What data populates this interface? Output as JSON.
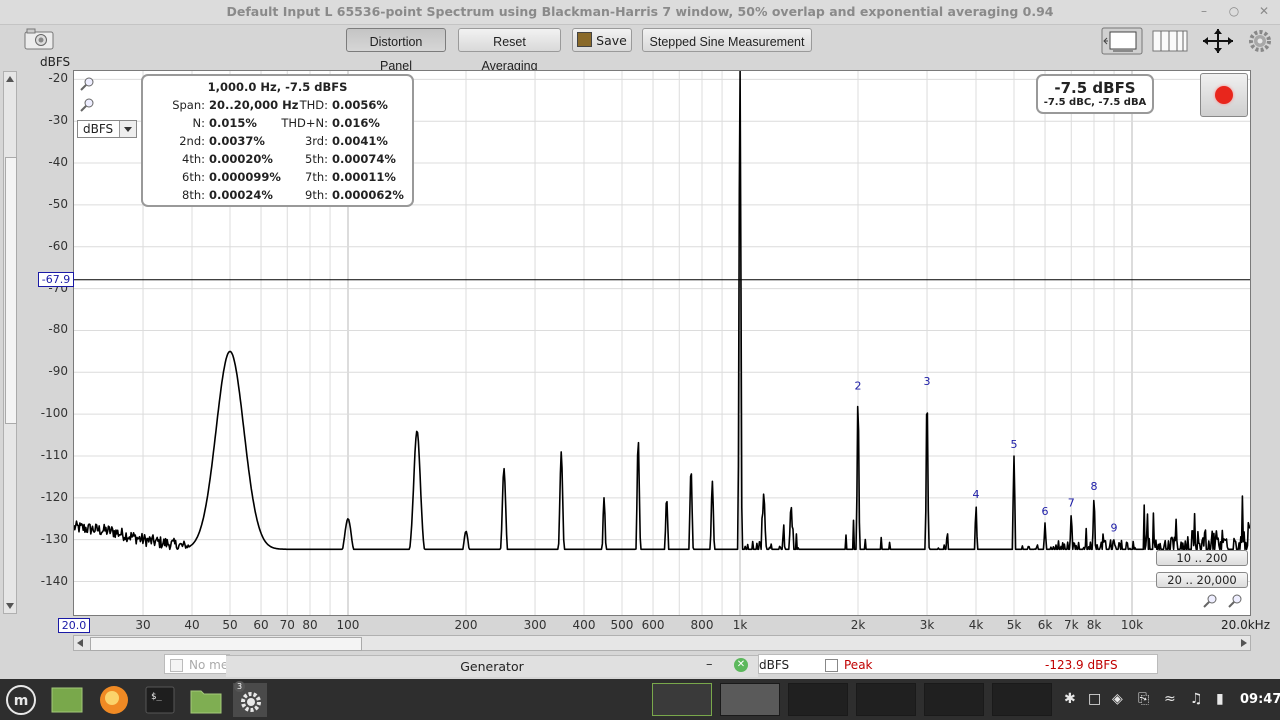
{
  "window": {
    "title": "Default Input L 65536-point Spectrum using Blackman-Harris 7 window, 50% overlap and exponential averaging 0.94"
  },
  "toolbar": {
    "distortion_panel": "Distortion Panel",
    "reset_averaging": "Reset Averaging",
    "save": "Save",
    "stepped_sine": "Stepped Sine Measurement"
  },
  "plot": {
    "y_unit": "dBFS",
    "unit_select": "dBFS",
    "cursor_level": "-67.9",
    "x_min_label": "20.0",
    "x_max_label": "20.0kHz",
    "range_y": "10 .. 200",
    "range_x": "20 .. 20,000"
  },
  "distortion": {
    "header": "1,000.0 Hz, -7.5 dBFS",
    "rows": [
      {
        "l1": "Span:",
        "v1": "20..20,000 Hz",
        "l2": "THD:",
        "v2": "0.0056%"
      },
      {
        "l1": "N:",
        "v1": "0.015%",
        "l2": "THD+N:",
        "v2": "0.016%"
      },
      {
        "l1": "2nd:",
        "v1": "0.0037%",
        "l2": "3rd:",
        "v2": "0.0041%"
      },
      {
        "l1": "4th:",
        "v1": "0.00020%",
        "l2": "5th:",
        "v2": "0.00074%"
      },
      {
        "l1": "6th:",
        "v1": "0.000099%",
        "l2": "7th:",
        "v2": "0.00011%"
      },
      {
        "l1": "8th:",
        "v1": "0.00024%",
        "l2": "9th:",
        "v2": "0.000062%"
      }
    ]
  },
  "level": {
    "main": "-7.5 dBFS",
    "sub": "-7.5 dBC, -7.5 dBA"
  },
  "status": {
    "no_measurement": "No me",
    "left_unit": "dBFS",
    "peak_label": "Peak",
    "peak_value": "-123.9 dBFS",
    "generator": "Generator"
  },
  "taskbar": {
    "badge": "3",
    "clock": "09:47"
  },
  "colors": {
    "trace": "#000000",
    "harmonic_label": "#1a1aa6",
    "record": "#e8261c",
    "peak_text": "#c00000",
    "cursor_label": "#1a1aa6",
    "gen_close": "#5cb85c"
  },
  "chart_data": {
    "type": "line",
    "x_scale": "log",
    "xlim": [
      20,
      20000
    ],
    "ylim": [
      -148,
      -18
    ],
    "ylabel": "dBFS",
    "grid": true,
    "y_ticks": [
      -20,
      -30,
      -40,
      -50,
      -60,
      -70,
      -80,
      -90,
      -100,
      -110,
      -120,
      -130,
      -140
    ],
    "x_ticks": [
      {
        "v": 30,
        "label": "30"
      },
      {
        "v": 40,
        "label": "40"
      },
      {
        "v": 50,
        "label": "50"
      },
      {
        "v": 60,
        "label": "60"
      },
      {
        "v": 70,
        "label": "70"
      },
      {
        "v": 80,
        "label": "80"
      },
      {
        "v": 100,
        "label": "100"
      },
      {
        "v": 200,
        "label": "200"
      },
      {
        "v": 300,
        "label": "300"
      },
      {
        "v": 400,
        "label": "400"
      },
      {
        "v": 500,
        "label": "500"
      },
      {
        "v": 600,
        "label": "600"
      },
      {
        "v": 800,
        "label": "800"
      },
      {
        "v": 1000,
        "label": "1k"
      },
      {
        "v": 2000,
        "label": "2k"
      },
      {
        "v": 3000,
        "label": "3k"
      },
      {
        "v": 4000,
        "label": "4k"
      },
      {
        "v": 5000,
        "label": "5k"
      },
      {
        "v": 6000,
        "label": "6k"
      },
      {
        "v": 7000,
        "label": "7k"
      },
      {
        "v": 8000,
        "label": "8k"
      },
      {
        "v": 10000,
        "label": "10k"
      }
    ],
    "cursor_y": -67.9,
    "baseline": [
      [
        20,
        -127
      ],
      [
        25,
        -128
      ],
      [
        30,
        -130
      ],
      [
        35,
        -131
      ],
      [
        40,
        -132
      ],
      [
        45,
        -133
      ],
      [
        48,
        -132
      ],
      [
        55,
        -133
      ],
      [
        60,
        -134
      ],
      [
        80,
        -134
      ],
      [
        100,
        -135
      ],
      [
        200,
        -135
      ],
      [
        500,
        -136
      ],
      [
        900,
        -136
      ],
      [
        1100,
        -133
      ],
      [
        1500,
        -135
      ],
      [
        3000,
        -136
      ],
      [
        5000,
        -136
      ],
      [
        7000,
        -135
      ],
      [
        10000,
        -134
      ],
      [
        15000,
        -132
      ],
      [
        20000,
        -130
      ]
    ],
    "peaks": [
      {
        "f": 50,
        "db": -85,
        "w": 0.05
      },
      {
        "f": 100,
        "db": -125,
        "w": 0.012
      },
      {
        "f": 150,
        "db": -104,
        "w": 0.012
      },
      {
        "f": 200,
        "db": -128,
        "w": 0.008
      },
      {
        "f": 250,
        "db": -113,
        "w": 0.006
      },
      {
        "f": 350,
        "db": -109,
        "w": 0.005
      },
      {
        "f": 450,
        "db": -120,
        "w": 0.004
      },
      {
        "f": 550,
        "db": -106,
        "w": 0.004
      },
      {
        "f": 650,
        "db": -120,
        "w": 0.004
      },
      {
        "f": 750,
        "db": -113,
        "w": 0.004
      },
      {
        "f": 850,
        "db": -116,
        "w": 0.004
      },
      {
        "f": 1000,
        "db": -7.5,
        "w": 0.003
      },
      {
        "f": 1150,
        "db": -119,
        "w": 0.004
      },
      {
        "f": 1350,
        "db": -122,
        "w": 0.004
      },
      {
        "f": 2000,
        "db": -96,
        "w": 0.003
      },
      {
        "f": 3000,
        "db": -95,
        "w": 0.003
      },
      {
        "f": 4000,
        "db": -122,
        "w": 0.003
      },
      {
        "f": 5000,
        "db": -110,
        "w": 0.003
      },
      {
        "f": 6000,
        "db": -126,
        "w": 0.003
      },
      {
        "f": 7000,
        "db": -124,
        "w": 0.003
      },
      {
        "f": 8000,
        "db": -120,
        "w": 0.003
      },
      {
        "f": 9000,
        "db": -130,
        "w": 0.003
      }
    ],
    "harmonic_labels": [
      {
        "label": "2",
        "f": 2000,
        "db": -96
      },
      {
        "label": "3",
        "f": 3000,
        "db": -95
      },
      {
        "label": "4",
        "f": 4000,
        "db": -122
      },
      {
        "label": "5",
        "f": 5000,
        "db": -110
      },
      {
        "label": "6",
        "f": 6000,
        "db": -126
      },
      {
        "label": "7",
        "f": 7000,
        "db": -124
      },
      {
        "label": "8",
        "f": 8000,
        "db": -120
      },
      {
        "label": "9",
        "f": 9000,
        "db": -130
      }
    ]
  }
}
